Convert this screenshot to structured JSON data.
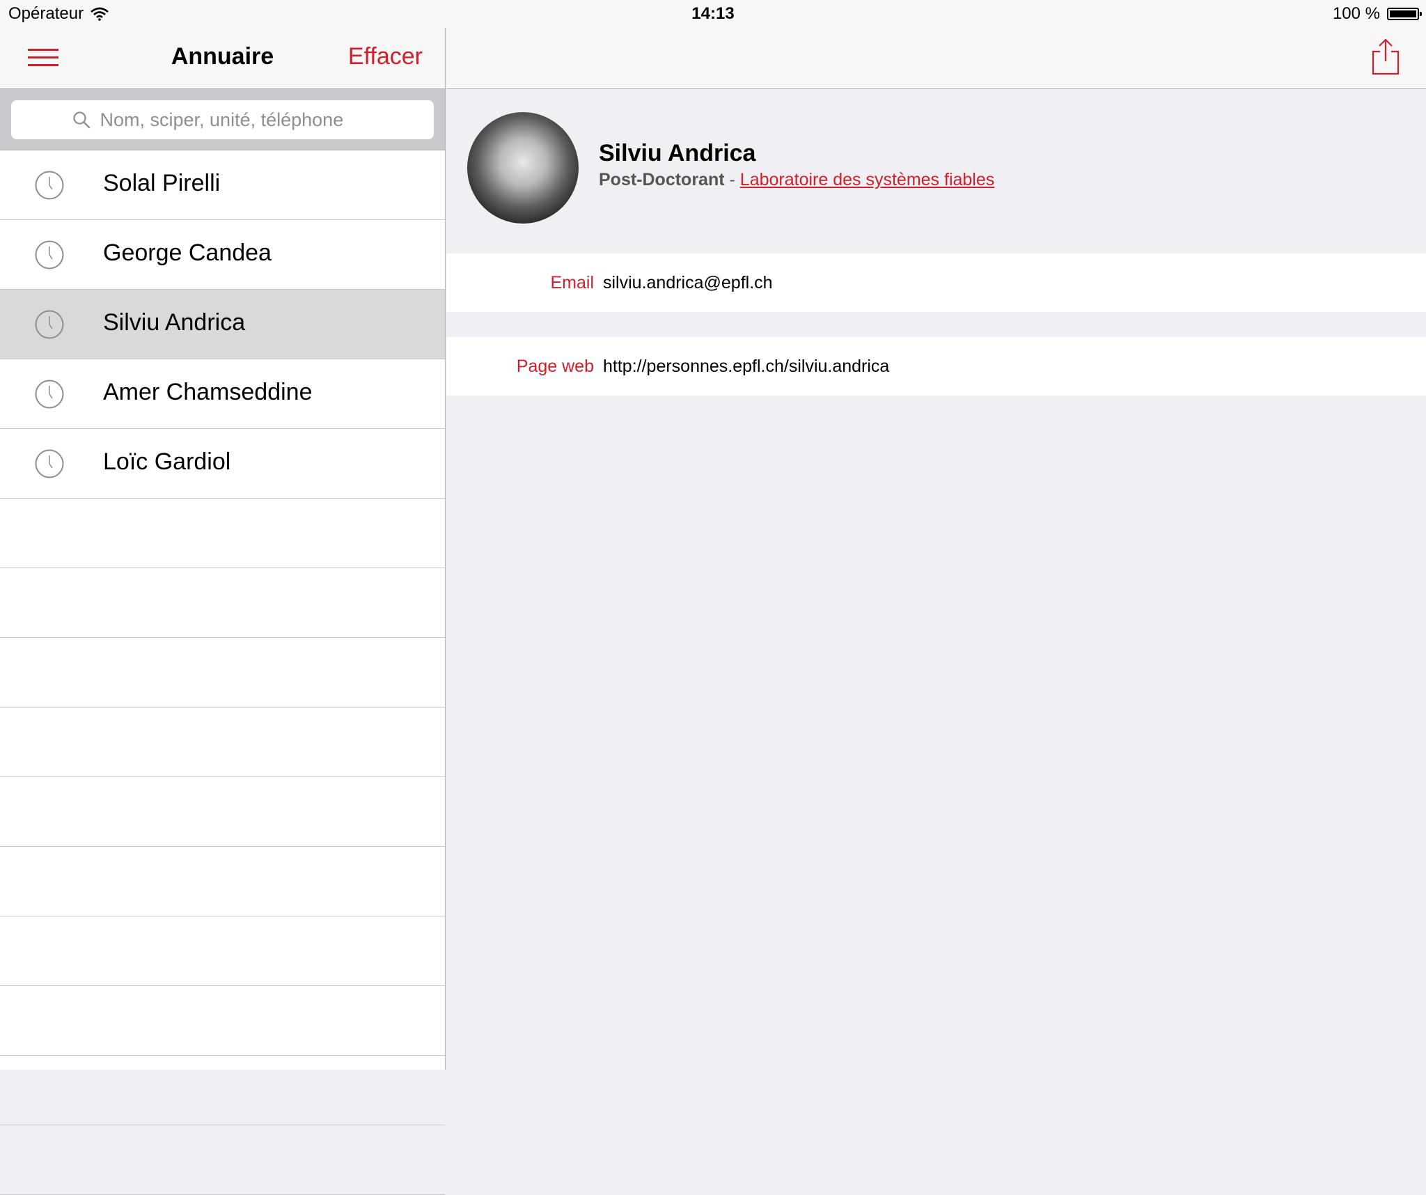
{
  "status_bar": {
    "carrier": "Opérateur",
    "time": "14:13",
    "battery": "100 %"
  },
  "left_nav": {
    "title": "Annuaire",
    "clear_label": "Effacer"
  },
  "search": {
    "placeholder": "Nom, sciper, unité, téléphone"
  },
  "recent_list": [
    {
      "name": "Solal Pirelli"
    },
    {
      "name": "George Candea"
    },
    {
      "name": "Silviu Andrica"
    },
    {
      "name": "Amer Chamseddine"
    },
    {
      "name": "Loïc Gardiol"
    }
  ],
  "person": {
    "name": "Silviu Andrica",
    "role": "Post-Doctorant",
    "separator": "-",
    "unit": "Laboratoire des systèmes fiables"
  },
  "fields": {
    "email": {
      "label": "Email",
      "value": "silviu.andrica@epfl.ch"
    },
    "web": {
      "label": "Page web",
      "value": "http://personnes.epfl.ch/silviu.andrica"
    }
  },
  "colors": {
    "accent": "#d0202a",
    "background": "#efeff4",
    "selected_row": "#d9d9d9"
  }
}
